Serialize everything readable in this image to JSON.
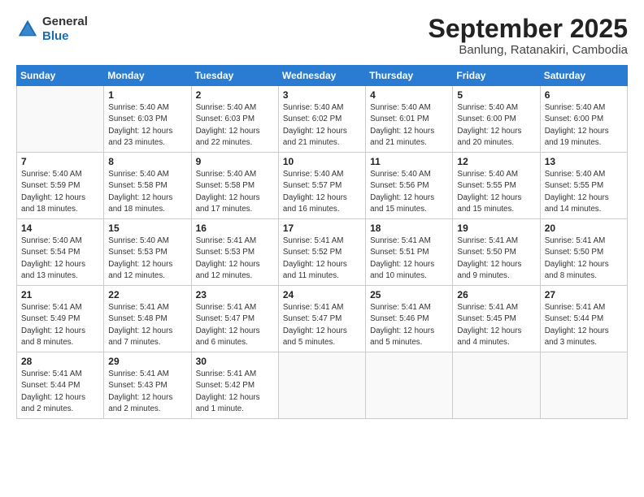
{
  "logo": {
    "general": "General",
    "blue": "Blue"
  },
  "title": "September 2025",
  "subtitle": "Banlung, Ratanakiri, Cambodia",
  "days_header": [
    "Sunday",
    "Monday",
    "Tuesday",
    "Wednesday",
    "Thursday",
    "Friday",
    "Saturday"
  ],
  "weeks": [
    [
      {
        "day": "",
        "info": ""
      },
      {
        "day": "1",
        "info": "Sunrise: 5:40 AM\nSunset: 6:03 PM\nDaylight: 12 hours\nand 23 minutes."
      },
      {
        "day": "2",
        "info": "Sunrise: 5:40 AM\nSunset: 6:03 PM\nDaylight: 12 hours\nand 22 minutes."
      },
      {
        "day": "3",
        "info": "Sunrise: 5:40 AM\nSunset: 6:02 PM\nDaylight: 12 hours\nand 21 minutes."
      },
      {
        "day": "4",
        "info": "Sunrise: 5:40 AM\nSunset: 6:01 PM\nDaylight: 12 hours\nand 21 minutes."
      },
      {
        "day": "5",
        "info": "Sunrise: 5:40 AM\nSunset: 6:00 PM\nDaylight: 12 hours\nand 20 minutes."
      },
      {
        "day": "6",
        "info": "Sunrise: 5:40 AM\nSunset: 6:00 PM\nDaylight: 12 hours\nand 19 minutes."
      }
    ],
    [
      {
        "day": "7",
        "info": "Sunrise: 5:40 AM\nSunset: 5:59 PM\nDaylight: 12 hours\nand 18 minutes."
      },
      {
        "day": "8",
        "info": "Sunrise: 5:40 AM\nSunset: 5:58 PM\nDaylight: 12 hours\nand 18 minutes."
      },
      {
        "day": "9",
        "info": "Sunrise: 5:40 AM\nSunset: 5:58 PM\nDaylight: 12 hours\nand 17 minutes."
      },
      {
        "day": "10",
        "info": "Sunrise: 5:40 AM\nSunset: 5:57 PM\nDaylight: 12 hours\nand 16 minutes."
      },
      {
        "day": "11",
        "info": "Sunrise: 5:40 AM\nSunset: 5:56 PM\nDaylight: 12 hours\nand 15 minutes."
      },
      {
        "day": "12",
        "info": "Sunrise: 5:40 AM\nSunset: 5:55 PM\nDaylight: 12 hours\nand 15 minutes."
      },
      {
        "day": "13",
        "info": "Sunrise: 5:40 AM\nSunset: 5:55 PM\nDaylight: 12 hours\nand 14 minutes."
      }
    ],
    [
      {
        "day": "14",
        "info": "Sunrise: 5:40 AM\nSunset: 5:54 PM\nDaylight: 12 hours\nand 13 minutes."
      },
      {
        "day": "15",
        "info": "Sunrise: 5:40 AM\nSunset: 5:53 PM\nDaylight: 12 hours\nand 12 minutes."
      },
      {
        "day": "16",
        "info": "Sunrise: 5:41 AM\nSunset: 5:53 PM\nDaylight: 12 hours\nand 12 minutes."
      },
      {
        "day": "17",
        "info": "Sunrise: 5:41 AM\nSunset: 5:52 PM\nDaylight: 12 hours\nand 11 minutes."
      },
      {
        "day": "18",
        "info": "Sunrise: 5:41 AM\nSunset: 5:51 PM\nDaylight: 12 hours\nand 10 minutes."
      },
      {
        "day": "19",
        "info": "Sunrise: 5:41 AM\nSunset: 5:50 PM\nDaylight: 12 hours\nand 9 minutes."
      },
      {
        "day": "20",
        "info": "Sunrise: 5:41 AM\nSunset: 5:50 PM\nDaylight: 12 hours\nand 8 minutes."
      }
    ],
    [
      {
        "day": "21",
        "info": "Sunrise: 5:41 AM\nSunset: 5:49 PM\nDaylight: 12 hours\nand 8 minutes."
      },
      {
        "day": "22",
        "info": "Sunrise: 5:41 AM\nSunset: 5:48 PM\nDaylight: 12 hours\nand 7 minutes."
      },
      {
        "day": "23",
        "info": "Sunrise: 5:41 AM\nSunset: 5:47 PM\nDaylight: 12 hours\nand 6 minutes."
      },
      {
        "day": "24",
        "info": "Sunrise: 5:41 AM\nSunset: 5:47 PM\nDaylight: 12 hours\nand 5 minutes."
      },
      {
        "day": "25",
        "info": "Sunrise: 5:41 AM\nSunset: 5:46 PM\nDaylight: 12 hours\nand 5 minutes."
      },
      {
        "day": "26",
        "info": "Sunrise: 5:41 AM\nSunset: 5:45 PM\nDaylight: 12 hours\nand 4 minutes."
      },
      {
        "day": "27",
        "info": "Sunrise: 5:41 AM\nSunset: 5:44 PM\nDaylight: 12 hours\nand 3 minutes."
      }
    ],
    [
      {
        "day": "28",
        "info": "Sunrise: 5:41 AM\nSunset: 5:44 PM\nDaylight: 12 hours\nand 2 minutes."
      },
      {
        "day": "29",
        "info": "Sunrise: 5:41 AM\nSunset: 5:43 PM\nDaylight: 12 hours\nand 2 minutes."
      },
      {
        "day": "30",
        "info": "Sunrise: 5:41 AM\nSunset: 5:42 PM\nDaylight: 12 hours\nand 1 minute."
      },
      {
        "day": "",
        "info": ""
      },
      {
        "day": "",
        "info": ""
      },
      {
        "day": "",
        "info": ""
      },
      {
        "day": "",
        "info": ""
      }
    ]
  ]
}
